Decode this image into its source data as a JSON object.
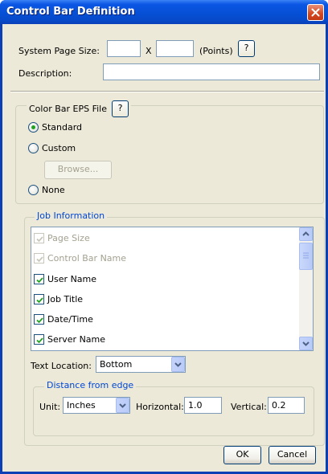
{
  "window": {
    "title": "Control Bar Definition"
  },
  "page_size": {
    "label": "System Page Size:",
    "width_value": "",
    "separator": "X",
    "height_value": "",
    "units": "(Points)",
    "help": "?"
  },
  "description": {
    "label": "Description:",
    "value": ""
  },
  "eps_group": {
    "legend": "Color Bar EPS File",
    "help": "?",
    "options": [
      {
        "label": "Standard",
        "checked": true
      },
      {
        "label": "Custom",
        "checked": false
      },
      {
        "label": "None",
        "checked": false
      }
    ],
    "browse_label": "Browse..."
  },
  "job_group": {
    "legend": "Job Information",
    "items": [
      {
        "label": "Page Size",
        "checked": true,
        "enabled": false
      },
      {
        "label": "Control Bar Name",
        "checked": true,
        "enabled": false
      },
      {
        "label": "User Name",
        "checked": true,
        "enabled": true
      },
      {
        "label": "Job Title",
        "checked": true,
        "enabled": true
      },
      {
        "label": "Date/Time",
        "checked": true,
        "enabled": true
      },
      {
        "label": "Server Name",
        "checked": true,
        "enabled": true
      }
    ],
    "text_location_label": "Text Location:",
    "text_location_value": "Bottom",
    "distance_group": {
      "legend": "Distance from edge",
      "unit_label": "Unit:",
      "unit_value": "Inches",
      "horizontal_label": "Horizontal:",
      "horizontal_value": "1.0",
      "vertical_label": "Vertical:",
      "vertical_value": "0.2"
    }
  },
  "buttons": {
    "ok": "OK",
    "cancel": "Cancel"
  },
  "colors": {
    "title_bar": "#0650d6",
    "dialog_bg": "#ece9d8",
    "accent_blue": "#0046d5",
    "check_green": "#21a121"
  }
}
